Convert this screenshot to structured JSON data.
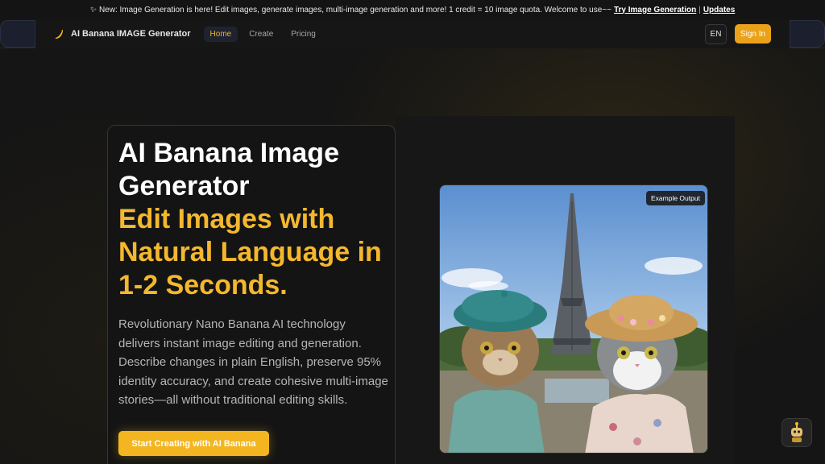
{
  "announcement": {
    "icon": "sparkle-icon",
    "text": "New: Image Generation is here! Edit images, generate images, multi-image generation and more! 1 credit = 10 image quota. Welcome to use~~",
    "link1": "Try Image Generation",
    "separator": "|",
    "link2": "Updates"
  },
  "header": {
    "brand_name": "AI Banana IMAGE Generator",
    "nav": [
      {
        "label": "Home",
        "active": true
      },
      {
        "label": "Create",
        "active": false
      },
      {
        "label": "Pricing",
        "active": false
      }
    ],
    "lang_label": "EN",
    "signin_label": "Sign In"
  },
  "hero": {
    "title": "AI Banana Image Generator",
    "subtitle": "Edit Images with Natural Language in 1-2 Seconds.",
    "description": "Revolutionary Nano Banana AI technology delivers instant image editing and generation. Describe changes in plain English, preserve 95% identity accuracy, and create cohesive multi-image stories—all without traditional editing skills.",
    "cta_label": "Start Creating with AI Banana"
  },
  "showcase": {
    "badge": "Example Output",
    "image_subject": "two cats in hats in front of the Eiffel Tower"
  },
  "colors": {
    "accent": "#f3b620",
    "background": "#151515",
    "active_nav": "#f0b429"
  }
}
